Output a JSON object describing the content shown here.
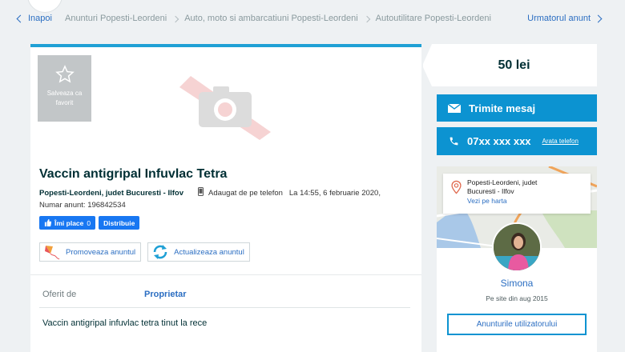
{
  "breadcrumb": {
    "back_label": "Inapoi",
    "items": [
      "Anunturi Popesti-Leordeni",
      "Auto, moto si ambarcatiuni Popesti-Leordeni",
      "Autoutilitare Popesti-Leordeni"
    ],
    "next_label": "Urmatorul anunt"
  },
  "listing": {
    "favorite_label": "Salveaza ca favorit",
    "title": "Vaccin antigripal Infuvlac Tetra",
    "location": "Popesti-Leordeni, judet Bucuresti - Ilfov",
    "added_info": "Adaugat de pe telefon   La 14:55, 6 februarie 2020,",
    "ad_number": "Numar anunt: 196842534",
    "like_label": "Îmi place",
    "like_count": "0",
    "share_label": "Distribuie",
    "promote_label": "Promoveaza anuntul",
    "refresh_label": "Actualizeaza anuntul",
    "offered_by_key": "Oferit de",
    "offered_by_value": "Proprietar",
    "description": "Vaccin antigripal infuvlac tetra tinut la rece"
  },
  "sidebar": {
    "price": "50 lei",
    "message_label": "Trimite mesaj",
    "phone_masked": "07xx xxx xxx",
    "phone_reveal_label": "Arata telefon",
    "map_location_line1": "Popesti-Leordeni, judet",
    "map_location_line2": "Bucuresti - Ilfov",
    "map_link_label": "Vezi pe harta",
    "user_name": "Simona",
    "member_since": "Pe site din aug 2015",
    "user_ads_label": "Anunturile utilizatorului"
  },
  "colors": {
    "accent": "#0c93d1",
    "link": "#2b6ec2",
    "text": "#002f34",
    "facebook": "#1877f2"
  }
}
